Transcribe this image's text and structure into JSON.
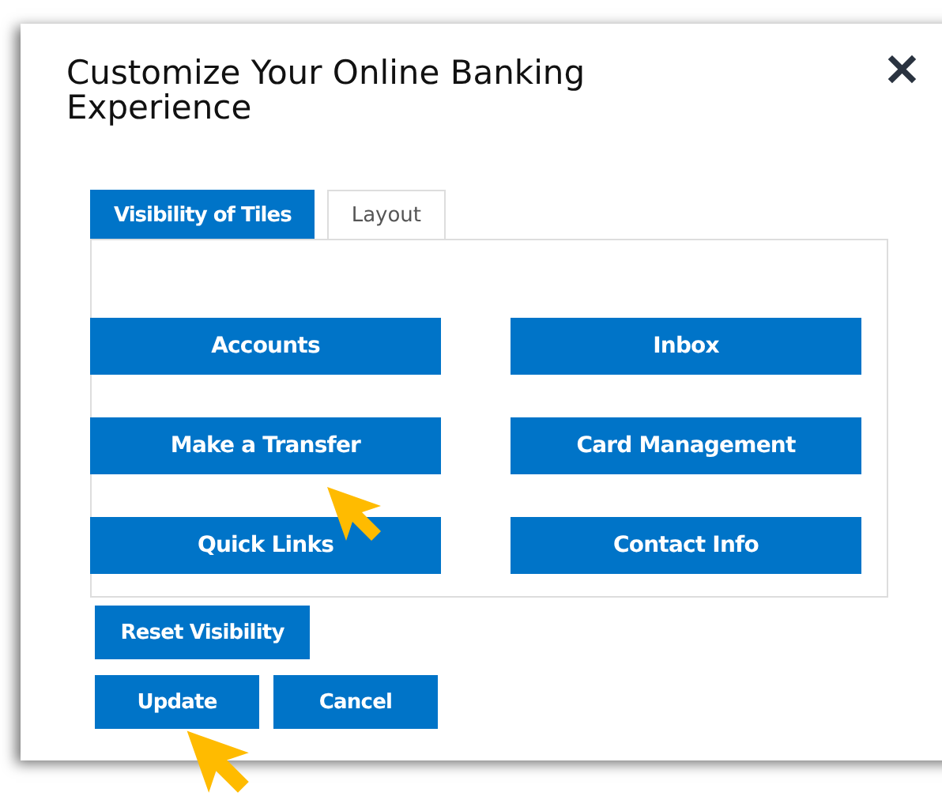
{
  "dialog": {
    "title": "Customize Your Online Banking Experience",
    "close": "✕"
  },
  "tabs": [
    {
      "label": "Visibility of Tiles",
      "selected": true
    },
    {
      "label": "Layout",
      "selected": false
    }
  ],
  "tiles": [
    "Accounts",
    "Inbox",
    "Make a Transfer",
    "Card Management",
    "Quick Links",
    "Contact Info"
  ],
  "reset_button": "Reset Visibility",
  "buttons": [
    "Update",
    "Cancel"
  ]
}
